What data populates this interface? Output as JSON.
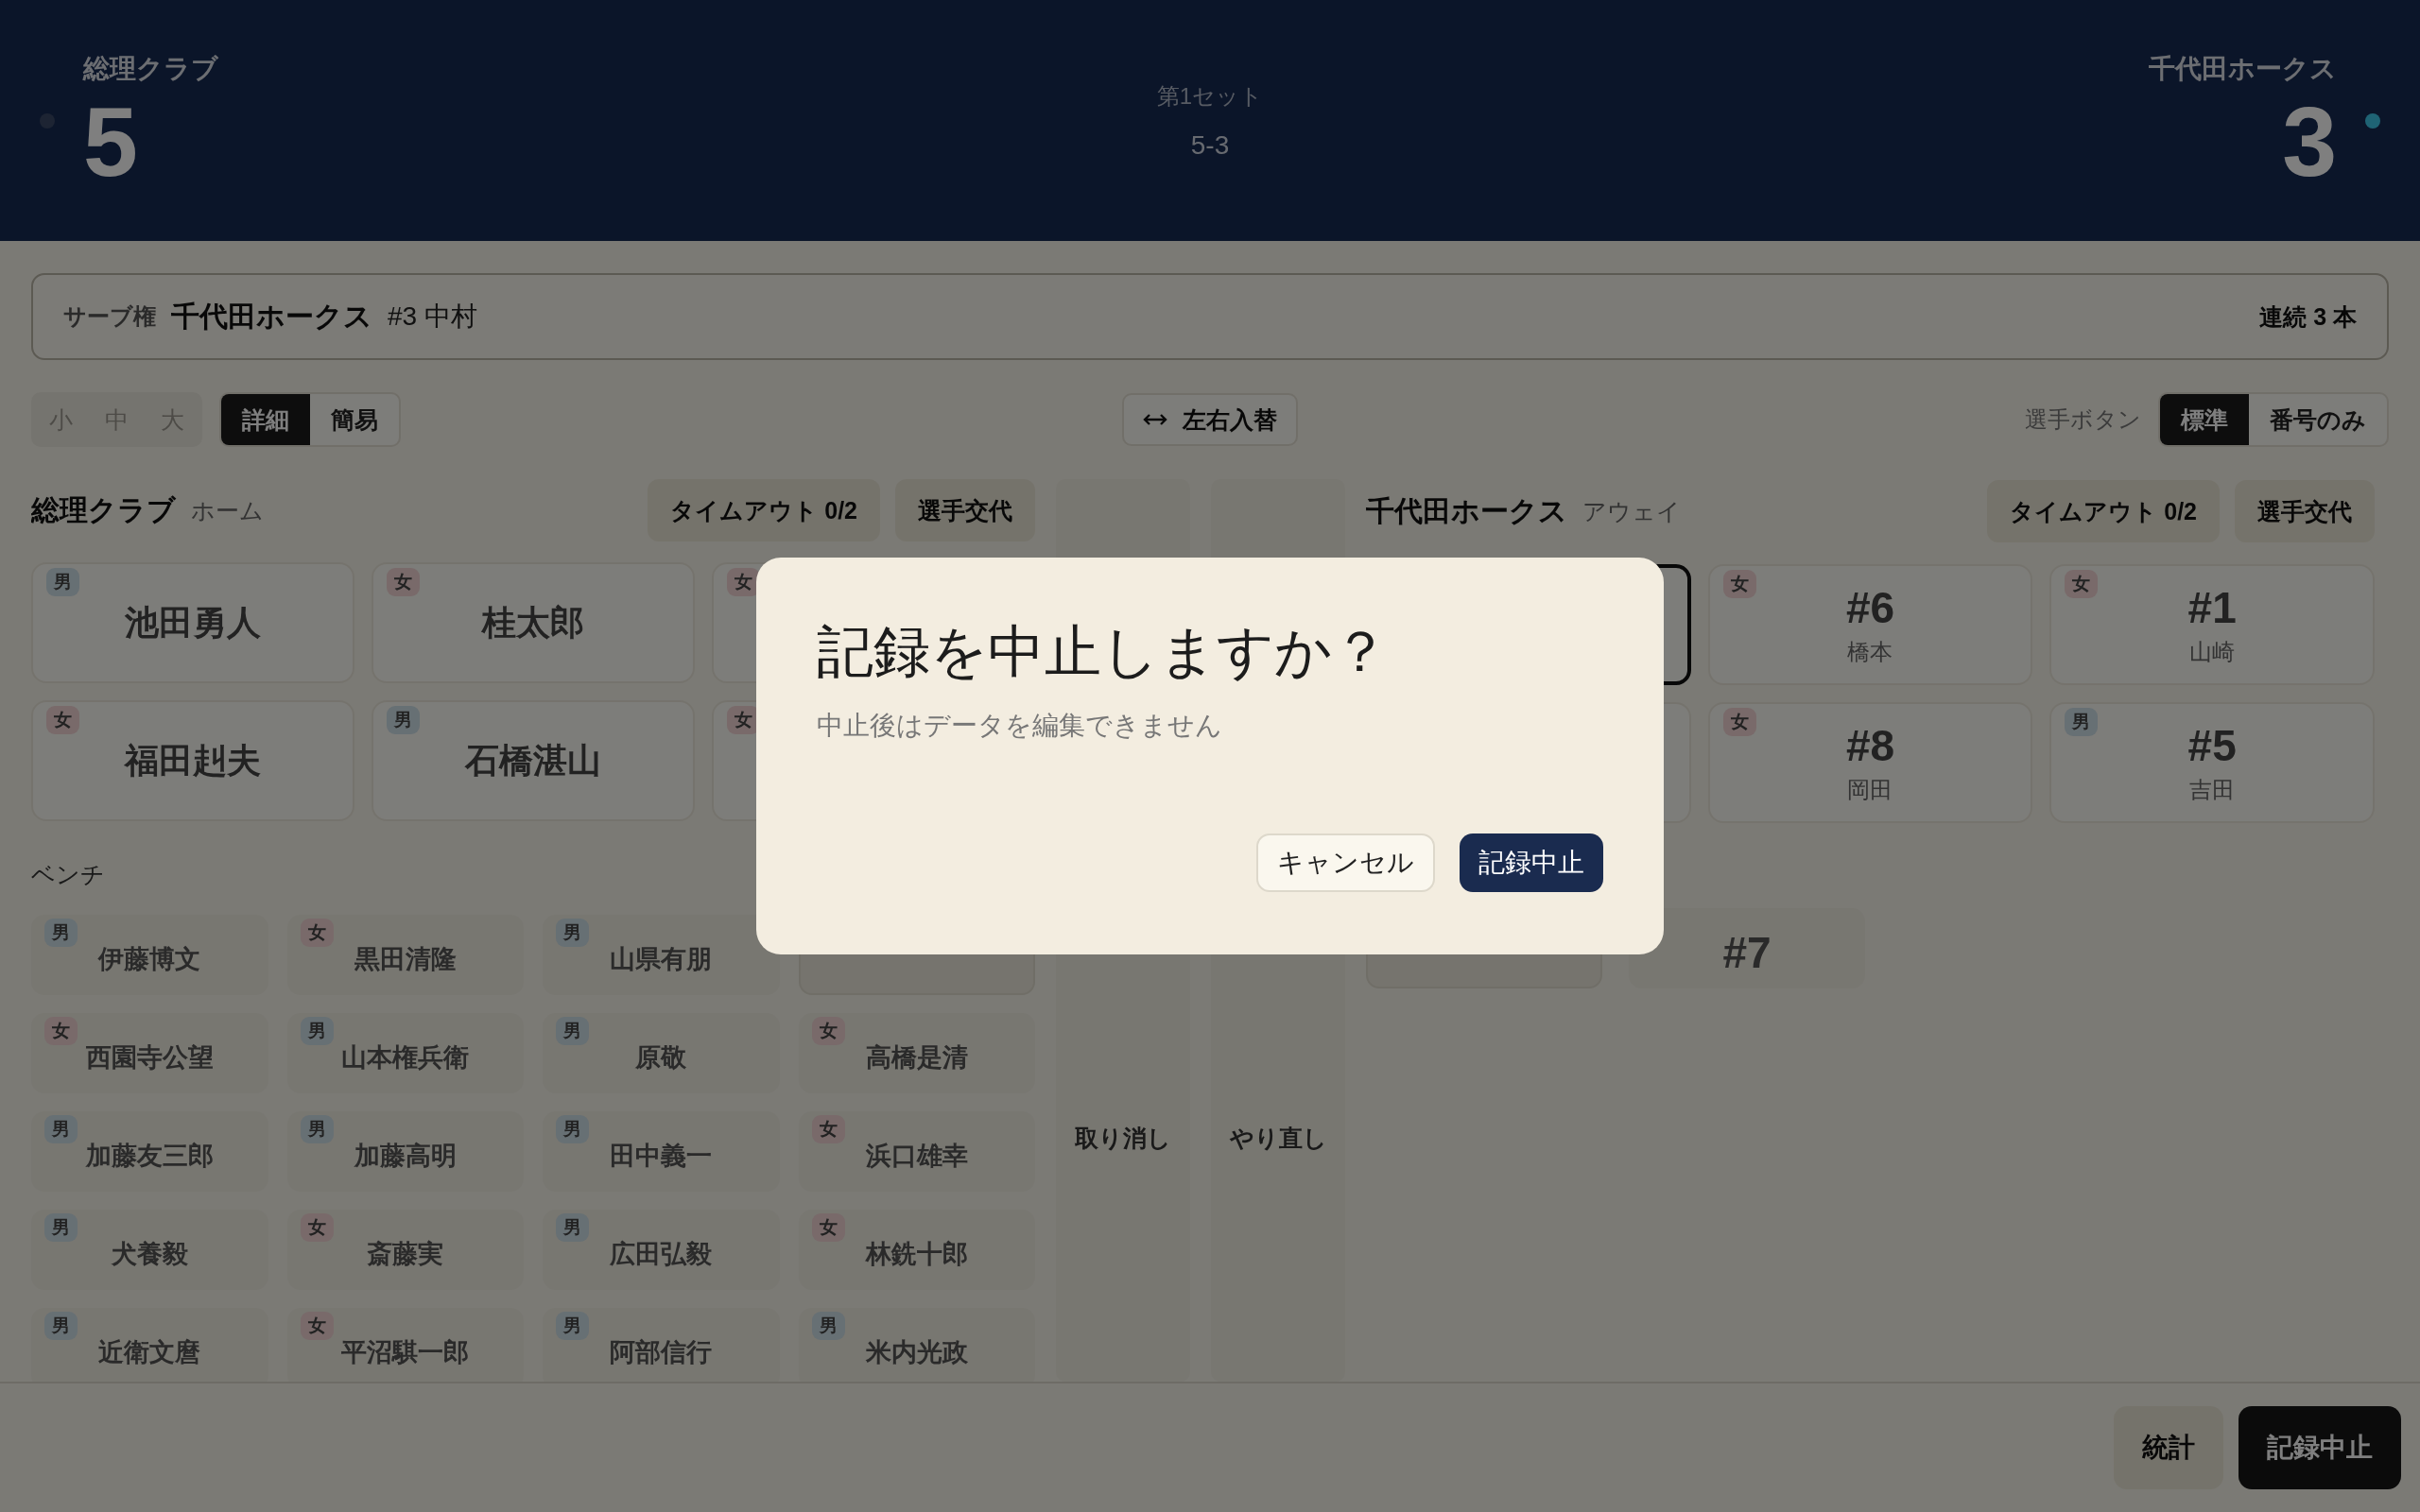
{
  "scoreboard": {
    "home": {
      "name": "総理クラブ",
      "score": "5",
      "serving": false
    },
    "away": {
      "name": "千代田ホークス",
      "score": "3",
      "serving": true
    },
    "set_label": "第1セット",
    "set_score": "5-3"
  },
  "serve_bar": {
    "label": "サーブ権",
    "team": "千代田ホークス",
    "player": "#3 中村",
    "streak": "連続 3 本"
  },
  "size_options": [
    {
      "label": "小",
      "selected": false,
      "disabled": true
    },
    {
      "label": "中",
      "selected": false,
      "disabled": true
    },
    {
      "label": "大",
      "selected": false,
      "disabled": true
    }
  ],
  "detail_options": [
    {
      "label": "詳細",
      "selected": true
    },
    {
      "label": "簡易",
      "selected": false
    }
  ],
  "swap_button": "左右入替",
  "player_button": {
    "label": "選手ボタン",
    "options": [
      {
        "label": "標準",
        "selected": true
      },
      {
        "label": "番号のみ",
        "selected": false
      }
    ]
  },
  "home_team": {
    "name": "総理クラブ",
    "side": "ホーム",
    "timeout_button": "タイムアウト 0/2",
    "substitute_button": "選手交代",
    "bench_label": "ベンチ",
    "court": [
      {
        "name": "池田勇人",
        "gender": "男",
        "kind": "male"
      },
      {
        "name": "桂太郎",
        "gender": "女",
        "kind": "female"
      },
      {
        "gender": "女",
        "kind": "female"
      },
      {
        "name": "福田赳夫",
        "gender": "女",
        "kind": "female"
      },
      {
        "name": "石橋湛山",
        "gender": "男",
        "kind": "male"
      },
      {
        "gender": "女",
        "kind": "female"
      }
    ],
    "bench": [
      {
        "name": "伊藤博文",
        "gender": "男",
        "kind": "male"
      },
      {
        "name": "黒田清隆",
        "gender": "女",
        "kind": "female"
      },
      {
        "name": "山県有朋",
        "gender": "男",
        "kind": "male"
      },
      {
        "kind": "hidden"
      },
      {
        "name": "西園寺公望",
        "gender": "女",
        "kind": "female"
      },
      {
        "name": "山本権兵衛",
        "gender": "男",
        "kind": "male"
      },
      {
        "name": "原敬",
        "gender": "男",
        "kind": "male"
      },
      {
        "name": "高橋是清",
        "gender": "女",
        "kind": "female"
      },
      {
        "name": "加藤友三郎",
        "gender": "男",
        "kind": "male"
      },
      {
        "name": "加藤高明",
        "gender": "男",
        "kind": "male"
      },
      {
        "name": "田中義一",
        "gender": "男",
        "kind": "male"
      },
      {
        "name": "浜口雄幸",
        "gender": "女",
        "kind": "female"
      },
      {
        "name": "犬養毅",
        "gender": "男",
        "kind": "male"
      },
      {
        "name": "斎藤実",
        "gender": "女",
        "kind": "female"
      },
      {
        "name": "広田弘毅",
        "gender": "男",
        "kind": "male"
      },
      {
        "name": "林銑十郎",
        "gender": "女",
        "kind": "female"
      },
      {
        "name": "近衛文麿",
        "gender": "男",
        "kind": "male"
      },
      {
        "name": "平沼騏一郎",
        "gender": "女",
        "kind": "female"
      },
      {
        "name": "阿部信行",
        "gender": "男",
        "kind": "male"
      },
      {
        "name": "米内光政",
        "gender": "男",
        "kind": "male"
      }
    ]
  },
  "history": {
    "undo": "取り消し",
    "redo": "やり直し"
  },
  "away_team": {
    "name": "千代田ホークス",
    "side": "アウェイ",
    "timeout_button": "タイムアウト 0/2",
    "substitute_button": "選手交代",
    "court": [
      {
        "selected": true
      },
      {
        "number": "#6",
        "name": "橋本",
        "gender": "女",
        "kind": "female",
        "selected": false
      },
      {
        "number": "#1",
        "name": "山崎",
        "gender": "女",
        "kind": "female",
        "selected": false
      },
      {
        "selected": false
      },
      {
        "number": "#8",
        "name": "岡田",
        "gender": "女",
        "kind": "female",
        "selected": false
      },
      {
        "number": "#5",
        "name": "吉田",
        "gender": "男",
        "kind": "male",
        "selected": false
      }
    ],
    "bench": [
      {
        "kind": "hidden"
      },
      {
        "number": "#7",
        "kind": "plain"
      }
    ]
  },
  "footer_buttons": [
    {
      "label": "統計",
      "kind": "secondary"
    },
    {
      "label": "記録中止",
      "kind": "primary"
    }
  ],
  "dialog": {
    "title": "記録を中止しますか？",
    "message": "中止後はデータを編集できません",
    "buttons": [
      {
        "label": "キャンセル",
        "kind": "secondary"
      },
      {
        "label": "記録中止",
        "kind": "primary"
      }
    ]
  }
}
